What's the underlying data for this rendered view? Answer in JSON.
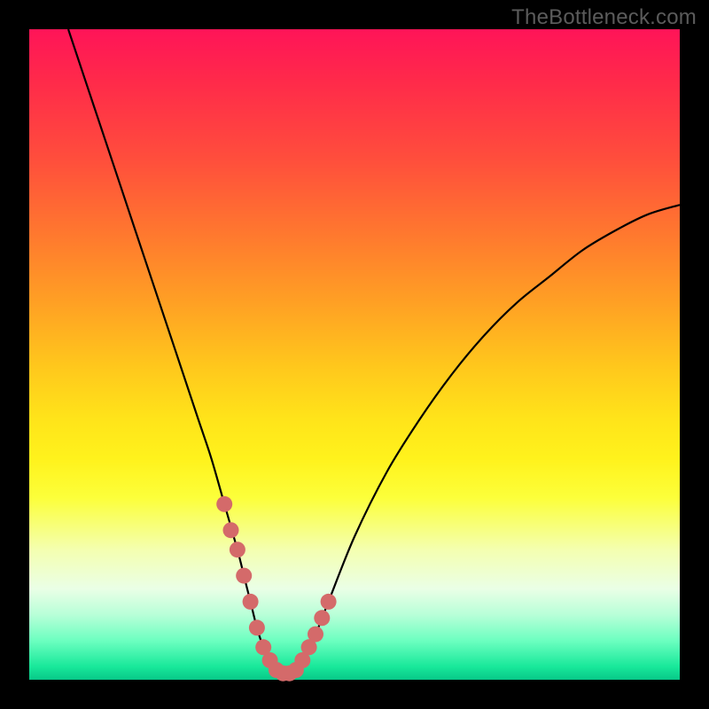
{
  "watermark": "TheBottleneck.com",
  "chart_data": {
    "type": "line",
    "title": "",
    "xlabel": "",
    "ylabel": "",
    "xlim": [
      0,
      100
    ],
    "ylim": [
      0,
      100
    ],
    "series": [
      {
        "name": "bottleneck-curve",
        "x": [
          6,
          10,
          14,
          18,
          22,
          26,
          28,
          30,
          32,
          33,
          34,
          35,
          36,
          37,
          38,
          39,
          40,
          41,
          42,
          44,
          46,
          50,
          55,
          60,
          65,
          70,
          75,
          80,
          85,
          90,
          95,
          100
        ],
        "y": [
          100,
          88,
          76,
          64,
          52,
          40,
          34,
          27,
          20,
          16,
          12,
          8,
          5,
          3,
          1.5,
          1,
          1,
          1.5,
          3,
          7,
          12,
          22,
          32,
          40,
          47,
          53,
          58,
          62,
          66,
          69,
          71.5,
          73
        ]
      }
    ],
    "highlight_points": {
      "name": "threshold-markers",
      "color": "#d46a6a",
      "x": [
        30,
        31,
        32,
        33,
        34,
        35,
        36,
        37,
        38,
        39,
        40,
        41,
        42,
        43,
        44,
        45,
        46
      ],
      "y": [
        27,
        23,
        20,
        16,
        12,
        8,
        5,
        3,
        1.5,
        1,
        1,
        1.5,
        3,
        5,
        7,
        9.5,
        12
      ]
    },
    "gradient_stops": [
      {
        "pos": 0.0,
        "color": "#ff1458"
      },
      {
        "pos": 0.2,
        "color": "#ff4e3c"
      },
      {
        "pos": 0.42,
        "color": "#ffa024"
      },
      {
        "pos": 0.6,
        "color": "#ffe41a"
      },
      {
        "pos": 0.8,
        "color": "#f4ffb0"
      },
      {
        "pos": 0.94,
        "color": "#6cffc0"
      },
      {
        "pos": 1.0,
        "color": "#08c888"
      }
    ]
  }
}
